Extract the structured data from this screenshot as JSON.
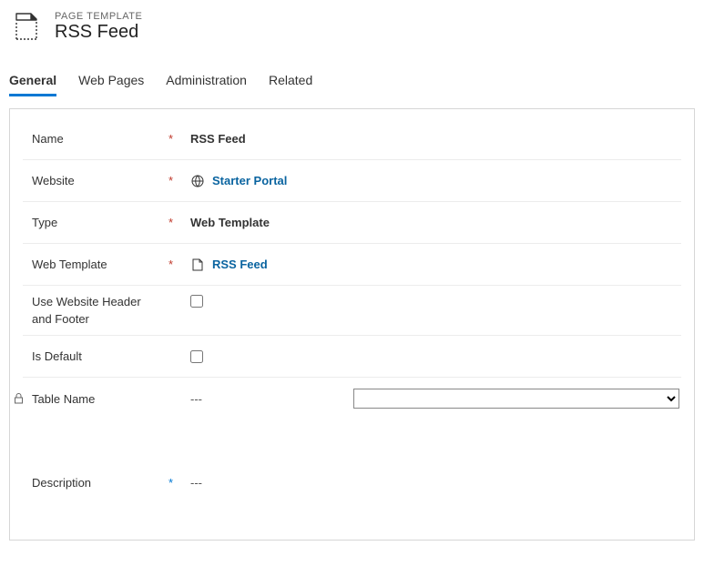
{
  "header": {
    "entity_label": "PAGE TEMPLATE",
    "title": "RSS Feed"
  },
  "tabs": [
    {
      "label": "General",
      "active": true
    },
    {
      "label": "Web Pages",
      "active": false
    },
    {
      "label": "Administration",
      "active": false
    },
    {
      "label": "Related",
      "active": false
    }
  ],
  "form": {
    "name": {
      "label": "Name",
      "required": true,
      "value": "RSS Feed"
    },
    "website": {
      "label": "Website",
      "required": true,
      "value": "Starter Portal"
    },
    "type": {
      "label": "Type",
      "required": true,
      "value": "Web Template"
    },
    "web_template": {
      "label": "Web Template",
      "required": true,
      "value": "RSS Feed"
    },
    "use_header_footer": {
      "label_line1": "Use Website Header",
      "label_line2": "and Footer",
      "label": "Use Website Header and Footer",
      "checked": false
    },
    "is_default": {
      "label": "Is Default",
      "checked": false
    },
    "table_name": {
      "label": "Table Name",
      "locked": true,
      "value": "---",
      "select_value": ""
    },
    "description": {
      "label": "Description",
      "recommended": true,
      "value": "---"
    }
  }
}
